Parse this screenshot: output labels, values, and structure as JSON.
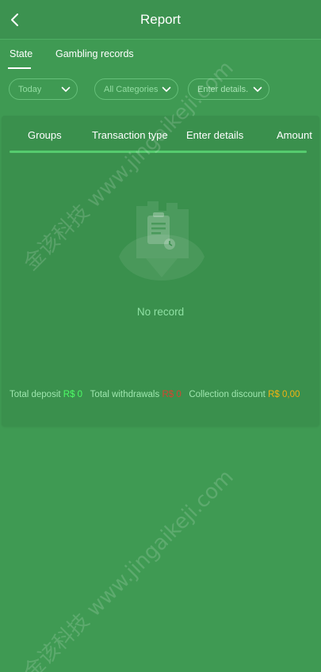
{
  "header": {
    "title": "Report",
    "back_icon": "chevron-left-icon"
  },
  "tabs": [
    {
      "label": "State",
      "active": true
    },
    {
      "label": "Gambling records",
      "active": false
    }
  ],
  "filters": {
    "date": {
      "value": "Today",
      "icon": "chevron-down-icon"
    },
    "category": {
      "value": "All Categories",
      "icon": "chevron-down-icon"
    },
    "details": {
      "placeholder": "Enter details.",
      "icon": "chevron-down-icon"
    }
  },
  "table": {
    "columns": [
      "Groups",
      "Transaction type",
      "Enter details",
      "Amount"
    ],
    "rows": []
  },
  "empty_state": {
    "text": "No record",
    "icon": "empty-document-icon"
  },
  "summary": {
    "deposit_label": "Total deposit",
    "deposit_value": "R$ 0",
    "withdrawals_label": "Total withdrawals",
    "withdrawals_value": "R$ 0",
    "discount_label": "Collection discount",
    "discount_value": "R$ 0,00"
  },
  "colors": {
    "background": "#3f9a53",
    "panel": "#3a904d",
    "accent": "#55cc6e",
    "deposit": "#4dfc66",
    "withdrawals": "#d6442f",
    "discount": "#f3b312"
  },
  "watermark": "金该科技 www.jingaikeji.com"
}
